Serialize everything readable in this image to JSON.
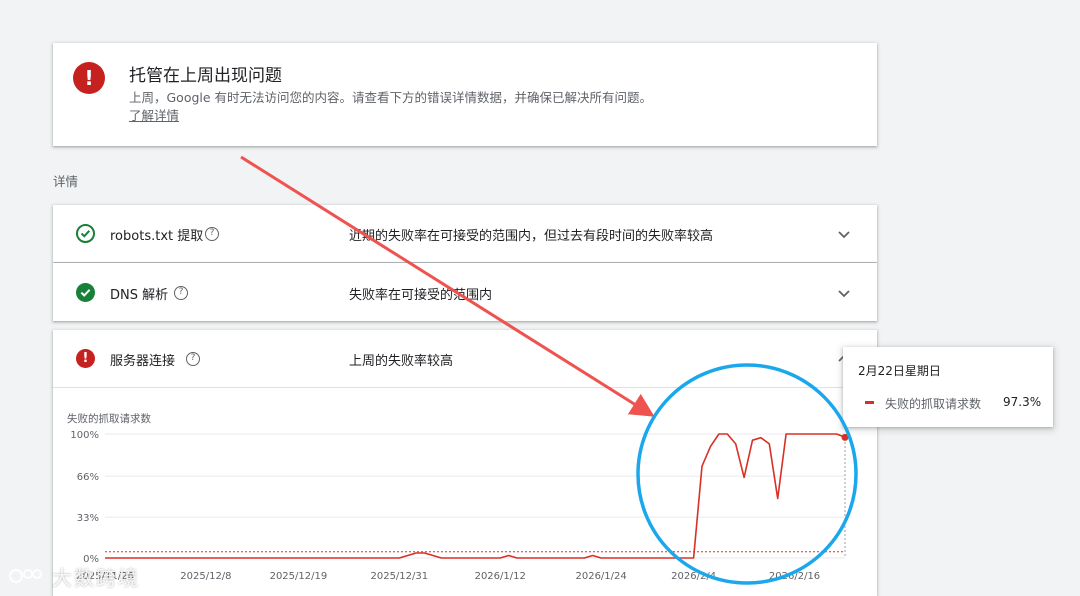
{
  "alert": {
    "title": "托管在上周出现问题",
    "body": "上周，Google 有时无法访问您的内容。请查看下方的错误详情数据，并确保已解决所有问题。",
    "link": "了解详情"
  },
  "details_label": "详情",
  "rows": [
    {
      "name": "robots.txt 提取",
      "status": "近期的失败率在可接受的范围内，但过去有段时间的失败率较高",
      "state": "ok-history"
    },
    {
      "name": "DNS 解析",
      "status": "失败率在可接受的范围内",
      "state": "ok"
    },
    {
      "name": "服务器连接",
      "status": "上周的失败率较高",
      "state": "error"
    }
  ],
  "help_glyph": "?",
  "colors": {
    "error": "#c5221f",
    "ok": "#188038",
    "series": "#d93025",
    "annotation": "#ef5350",
    "circle": "#1aa7ec"
  },
  "chart_data": {
    "type": "line",
    "ylabel": "失败的抓取请求数",
    "y_ticks": [
      "0%",
      "33%",
      "66%",
      "100%"
    ],
    "ylim": [
      0,
      100
    ],
    "x_ticks": [
      "2025/11/26",
      "2025/12/8",
      "2025/12/19",
      "2025/12/31",
      "2026/1/12",
      "2026/1/24",
      "2026/2/4",
      "2026/2/16"
    ],
    "series": [
      {
        "name": "失败的抓取请求数",
        "x": [
          "2025/11/26",
          "2025/12/31",
          "2026/1/1",
          "2026/1/2",
          "2026/1/3",
          "2026/1/4",
          "2026/1/5",
          "2026/1/12",
          "2026/1/13",
          "2026/1/14",
          "2026/1/22",
          "2026/1/23",
          "2026/1/24",
          "2026/2/4",
          "2026/2/5",
          "2026/2/6",
          "2026/2/7",
          "2026/2/8",
          "2026/2/9",
          "2026/2/10",
          "2026/2/11",
          "2026/2/12",
          "2026/2/13",
          "2026/2/14",
          "2026/2/15",
          "2026/2/16",
          "2026/2/17",
          "2026/2/18",
          "2026/2/19",
          "2026/2/20",
          "2026/2/21",
          "2026/2/22"
        ],
        "values": [
          0,
          0,
          2,
          4,
          4,
          2,
          0,
          0,
          2,
          0,
          0,
          2,
          0,
          0,
          74,
          90,
          100,
          100,
          92,
          65,
          95,
          97,
          92,
          48,
          100,
          100,
          100,
          100,
          100,
          100,
          100,
          97.3
        ]
      }
    ],
    "threshold": 5,
    "grid": true,
    "legend": "none"
  },
  "tooltip": {
    "date": "2月22日星期日",
    "series": "失败的抓取请求数",
    "value": "97.3%"
  },
  "watermark": "大数跨境"
}
